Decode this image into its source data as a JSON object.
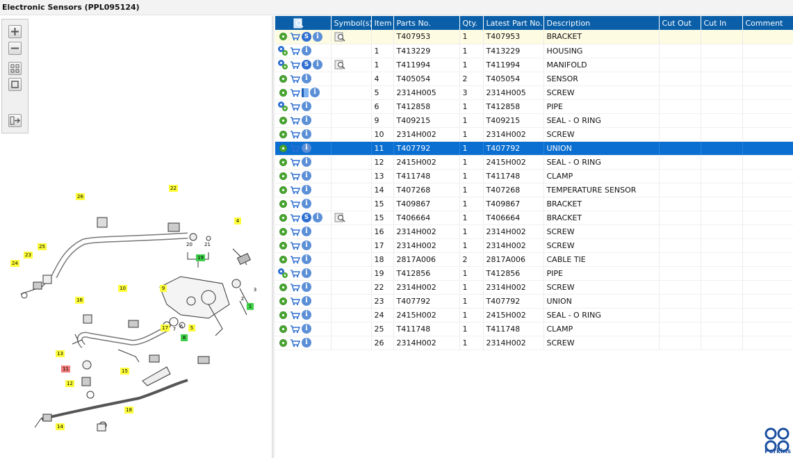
{
  "window": {
    "title": "Electronic Sensors (PPL095124)"
  },
  "toolbar": {
    "icons": [
      "zoom-in-icon",
      "zoom-out-icon",
      "fit-all-icon",
      "fit-window-icon",
      "export-icon"
    ]
  },
  "grid": {
    "headers": [
      "",
      "Symbol(s)",
      "Item",
      "Parts No.",
      "Qty.",
      "Latest Part No.",
      "Description",
      "Cut Out",
      "Cut In",
      "Comment"
    ],
    "rows": [
      {
        "icons": [
          "gear",
          "cart",
          "service",
          "info"
        ],
        "symbol": "magnifier",
        "item": "",
        "part": "T407953",
        "qty": "1",
        "latest": "T407953",
        "desc": "BRACKET"
      },
      {
        "icons": [
          "gears",
          "cart",
          "info"
        ],
        "symbol": "",
        "item": "1",
        "part": "T413229",
        "qty": "1",
        "latest": "T413229",
        "desc": "HOUSING"
      },
      {
        "icons": [
          "gears",
          "cart",
          "service",
          "info"
        ],
        "symbol": "magnifier",
        "item": "1",
        "part": "T411994",
        "qty": "1",
        "latest": "T411994",
        "desc": "MANIFOLD"
      },
      {
        "icons": [
          "gear",
          "cart",
          "info"
        ],
        "symbol": "",
        "item": "4",
        "part": "T405054",
        "qty": "2",
        "latest": "T405054",
        "desc": "SENSOR"
      },
      {
        "icons": [
          "gear",
          "cart",
          "book",
          "info"
        ],
        "symbol": "",
        "item": "5",
        "part": "2314H005",
        "qty": "3",
        "latest": "2314H005",
        "desc": "SCREW"
      },
      {
        "icons": [
          "gears",
          "cart",
          "info"
        ],
        "symbol": "",
        "item": "6",
        "part": "T412858",
        "qty": "1",
        "latest": "T412858",
        "desc": "PIPE"
      },
      {
        "icons": [
          "gear",
          "cart",
          "info"
        ],
        "symbol": "",
        "item": "9",
        "part": "T409215",
        "qty": "1",
        "latest": "T409215",
        "desc": "SEAL - O RING"
      },
      {
        "icons": [
          "gear",
          "cart",
          "info"
        ],
        "symbol": "",
        "item": "10",
        "part": "2314H002",
        "qty": "1",
        "latest": "2314H002",
        "desc": "SCREW"
      },
      {
        "icons": [
          "gear",
          "cart",
          "info"
        ],
        "symbol": "",
        "item": "11",
        "part": "T407792",
        "qty": "1",
        "latest": "T407792",
        "desc": "UNION"
      },
      {
        "icons": [
          "gear",
          "cart",
          "info"
        ],
        "symbol": "",
        "item": "12",
        "part": "2415H002",
        "qty": "1",
        "latest": "2415H002",
        "desc": "SEAL - O RING"
      },
      {
        "icons": [
          "gear",
          "cart",
          "info"
        ],
        "symbol": "",
        "item": "13",
        "part": "T411748",
        "qty": "1",
        "latest": "T411748",
        "desc": "CLAMP"
      },
      {
        "icons": [
          "gear",
          "cart",
          "info"
        ],
        "symbol": "",
        "item": "14",
        "part": "T407268",
        "qty": "1",
        "latest": "T407268",
        "desc": "TEMPERATURE SENSOR"
      },
      {
        "icons": [
          "gear",
          "cart",
          "info"
        ],
        "symbol": "",
        "item": "15",
        "part": "T409867",
        "qty": "1",
        "latest": "T409867",
        "desc": "BRACKET"
      },
      {
        "icons": [
          "gear",
          "cart",
          "service",
          "info"
        ],
        "symbol": "magnifier",
        "item": "15",
        "part": "T406664",
        "qty": "1",
        "latest": "T406664",
        "desc": "BRACKET"
      },
      {
        "icons": [
          "gear",
          "cart",
          "info"
        ],
        "symbol": "",
        "item": "16",
        "part": "2314H002",
        "qty": "1",
        "latest": "2314H002",
        "desc": "SCREW"
      },
      {
        "icons": [
          "gear",
          "cart",
          "info"
        ],
        "symbol": "",
        "item": "17",
        "part": "2314H002",
        "qty": "1",
        "latest": "2314H002",
        "desc": "SCREW"
      },
      {
        "icons": [
          "gear",
          "cart",
          "info"
        ],
        "symbol": "",
        "item": "18",
        "part": "2817A006",
        "qty": "2",
        "latest": "2817A006",
        "desc": "CABLE TIE"
      },
      {
        "icons": [
          "gears",
          "cart",
          "info"
        ],
        "symbol": "",
        "item": "19",
        "part": "T412856",
        "qty": "1",
        "latest": "T412856",
        "desc": "PIPE"
      },
      {
        "icons": [
          "gear",
          "cart",
          "info"
        ],
        "symbol": "",
        "item": "22",
        "part": "2314H002",
        "qty": "1",
        "latest": "2314H002",
        "desc": "SCREW"
      },
      {
        "icons": [
          "gear",
          "cart",
          "info"
        ],
        "symbol": "",
        "item": "23",
        "part": "T407792",
        "qty": "1",
        "latest": "T407792",
        "desc": "UNION"
      },
      {
        "icons": [
          "gear",
          "cart",
          "info"
        ],
        "symbol": "",
        "item": "24",
        "part": "2415H002",
        "qty": "1",
        "latest": "2415H002",
        "desc": "SEAL - O RING"
      },
      {
        "icons": [
          "gear",
          "cart",
          "info"
        ],
        "symbol": "",
        "item": "25",
        "part": "T411748",
        "qty": "1",
        "latest": "T411748",
        "desc": "CLAMP"
      },
      {
        "icons": [
          "gear",
          "cart",
          "info"
        ],
        "symbol": "",
        "item": "26",
        "part": "2314H002",
        "qty": "1",
        "latest": "2314H002",
        "desc": "SCREW"
      }
    ],
    "selected_row_index": 8
  },
  "diagram": {
    "callouts": [
      {
        "label": "26",
        "style": "yellow"
      },
      {
        "label": "22",
        "style": "yellow"
      },
      {
        "label": "4",
        "style": "yellow"
      },
      {
        "label": "20",
        "style": "white"
      },
      {
        "label": "21",
        "style": "white"
      },
      {
        "label": "19",
        "style": "green"
      },
      {
        "label": "25",
        "style": "yellow"
      },
      {
        "label": "23",
        "style": "yellow"
      },
      {
        "label": "24",
        "style": "yellow"
      },
      {
        "label": "10",
        "style": "yellow"
      },
      {
        "label": "9",
        "style": "yellow"
      },
      {
        "label": "3",
        "style": "white"
      },
      {
        "label": "2",
        "style": "white"
      },
      {
        "label": "1",
        "style": "green"
      },
      {
        "label": "16",
        "style": "yellow"
      },
      {
        "label": "7",
        "style": "white"
      },
      {
        "label": "6",
        "style": "white"
      },
      {
        "label": "5",
        "style": "yellow"
      },
      {
        "label": "17",
        "style": "yellow"
      },
      {
        "label": "8",
        "style": "green"
      },
      {
        "label": "13",
        "style": "yellow"
      },
      {
        "label": "11",
        "style": "red"
      },
      {
        "label": "15",
        "style": "yellow"
      },
      {
        "label": "12",
        "style": "yellow"
      },
      {
        "label": "18",
        "style": "yellow"
      },
      {
        "label": "14",
        "style": "yellow"
      }
    ]
  },
  "brand": {
    "name": "Perkins"
  },
  "colors": {
    "header": "#0a5fa8",
    "selected": "#0a6fd1",
    "first_row": "#fdfbe2",
    "callout_yellow": "#fdfd3a",
    "callout_green": "#3fd04a",
    "callout_red": "#f07a7a"
  }
}
